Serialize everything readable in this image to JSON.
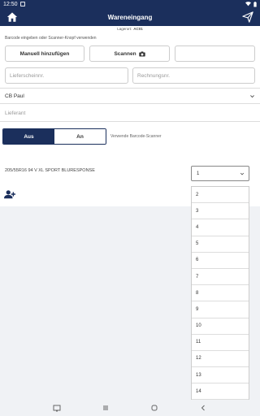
{
  "statusbar": {
    "time": "12:50",
    "battery": "◉ ▼ ▮"
  },
  "header": {
    "title": "Wareneingang"
  },
  "lagerort": {
    "label": "Lagerort:",
    "value": "AC01"
  },
  "hint": "Barcode eingeben oder Scanner-Knopf verwenden",
  "buttons": {
    "manual": "Manuell hinzufügen",
    "scan": "Scannen"
  },
  "inputs": {
    "lieferschein_placeholder": "Lieferscheinnr.",
    "rechnung_placeholder": "Rechnungsnr."
  },
  "supplier_select": {
    "value": "CB Paul"
  },
  "lieferant": {
    "placeholder": "Lieferant"
  },
  "scanner_toggle": {
    "off_label": "Aus",
    "on_label": "An",
    "selected": "Aus",
    "description": "Verwende Barcode-Scanner"
  },
  "product": {
    "name": "205/55R16 94 V XL SPORT BLURESPONSE"
  },
  "quantity": {
    "selected": "1",
    "options": [
      "2",
      "3",
      "4",
      "5",
      "6",
      "7",
      "8",
      "9",
      "10",
      "11",
      "12",
      "13",
      "14"
    ]
  },
  "colors": {
    "primary": "#1b2f5c"
  }
}
